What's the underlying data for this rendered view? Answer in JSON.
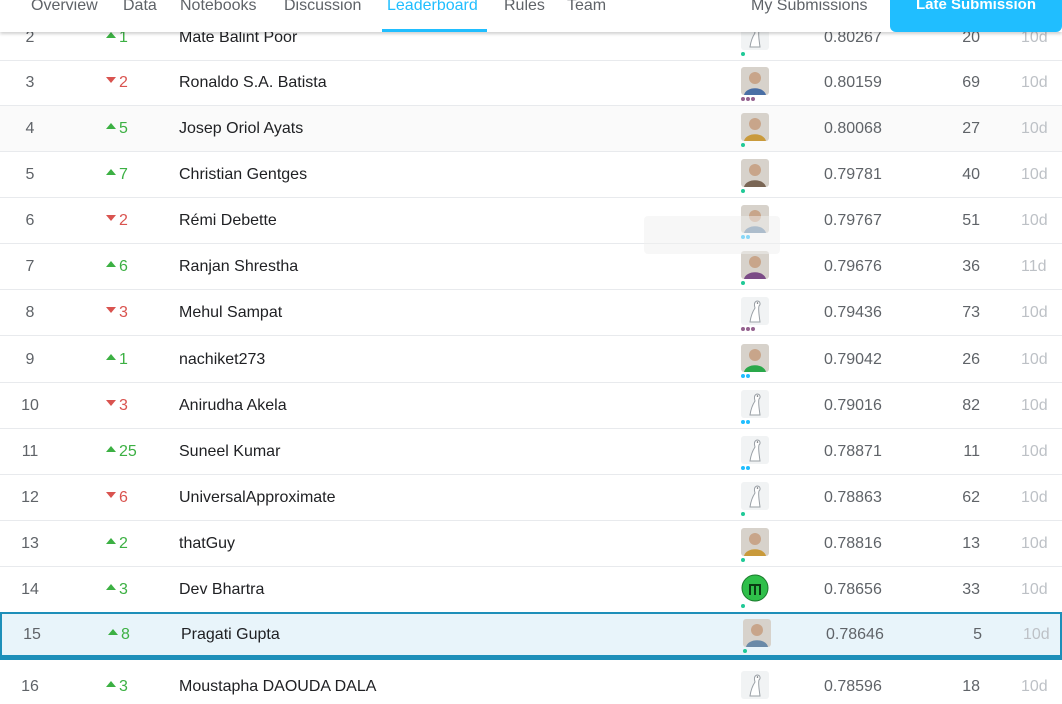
{
  "nav": {
    "tabs": [
      "Overview",
      "Data",
      "Notebooks",
      "Discussion",
      "Leaderboard",
      "Rules",
      "Team"
    ],
    "my_submissions": "My Submissions",
    "late_submission": "Late Submission",
    "accent": "#20beff"
  },
  "rows": [
    {
      "rank": "2",
      "dir": "up",
      "delta": "1",
      "name": "Mate Balint Poor",
      "avatar": "default-avatar-icon",
      "tier": "contributor",
      "score": "0.80267",
      "entries": "20",
      "last": "10d"
    },
    {
      "rank": "3",
      "dir": "down",
      "delta": "2",
      "name": "Ronaldo S.A. Batista",
      "avatar": "photo-avatar",
      "tier": "master",
      "score": "0.80159",
      "entries": "69",
      "last": "10d"
    },
    {
      "rank": "4",
      "dir": "up",
      "delta": "5",
      "name": "Josep Oriol Ayats",
      "avatar": "photo-avatar",
      "tier": "contributor",
      "score": "0.80068",
      "entries": "27",
      "last": "10d"
    },
    {
      "rank": "5",
      "dir": "up",
      "delta": "7",
      "name": "Christian Gentges",
      "avatar": "photo-avatar",
      "tier": "contributor",
      "score": "0.79781",
      "entries": "40",
      "last": "10d"
    },
    {
      "rank": "6",
      "dir": "down",
      "delta": "2",
      "name": "Rémi Debette",
      "avatar": "photo-avatar",
      "tier": "expert",
      "score": "0.79767",
      "entries": "51",
      "last": "10d"
    },
    {
      "rank": "7",
      "dir": "up",
      "delta": "6",
      "name": "Ranjan Shrestha",
      "avatar": "photo-avatar",
      "tier": "contributor",
      "score": "0.79676",
      "entries": "36",
      "last": "11d"
    },
    {
      "rank": "8",
      "dir": "down",
      "delta": "3",
      "name": "Mehul Sampat",
      "avatar": "default-avatar-icon",
      "tier": "master",
      "score": "0.79436",
      "entries": "73",
      "last": "10d"
    },
    {
      "rank": "9",
      "dir": "up",
      "delta": "1",
      "name": "nachiket273",
      "avatar": "photo-avatar",
      "tier": "expert",
      "score": "0.79042",
      "entries": "26",
      "last": "10d"
    },
    {
      "rank": "10",
      "dir": "down",
      "delta": "3",
      "name": "Anirudha Akela",
      "avatar": "default-avatar-icon",
      "tier": "expert",
      "score": "0.79016",
      "entries": "82",
      "last": "10d"
    },
    {
      "rank": "11",
      "dir": "up",
      "delta": "25",
      "name": "Suneel Kumar",
      "avatar": "default-avatar-icon",
      "tier": "expert",
      "score": "0.78871",
      "entries": "11",
      "last": "10d"
    },
    {
      "rank": "12",
      "dir": "down",
      "delta": "6",
      "name": "UniversalApproximate",
      "avatar": "default-avatar-icon",
      "tier": "contributor",
      "score": "0.78863",
      "entries": "62",
      "last": "10d"
    },
    {
      "rank": "13",
      "dir": "up",
      "delta": "2",
      "name": "thatGuy",
      "avatar": "photo-avatar",
      "tier": "contributor",
      "score": "0.78816",
      "entries": "13",
      "last": "10d"
    },
    {
      "rank": "14",
      "dir": "up",
      "delta": "3",
      "name": "Dev Bhartra",
      "avatar": "logo-avatar",
      "tier": "contributor",
      "score": "0.78656",
      "entries": "33",
      "last": "10d"
    },
    {
      "rank": "15",
      "dir": "up",
      "delta": "8",
      "name": "Pragati Gupta",
      "avatar": "photo-avatar",
      "tier": "contributor",
      "score": "0.78646",
      "entries": "5",
      "last": "10d"
    },
    {
      "rank": "16",
      "dir": "up",
      "delta": "3",
      "name": "Moustapha DAOUDA DALA",
      "avatar": "default-avatar-icon",
      "tier": "none",
      "score": "0.78596",
      "entries": "18",
      "last": "10d"
    }
  ],
  "colors": {
    "up": "#3cb043",
    "down": "#d9534f",
    "tier_contributor": "#20c997",
    "tier_expert": "#20beff",
    "tier_master": "#95628f",
    "highlight_border": "#1d8fb9",
    "highlight_bg": "#e8f4fa"
  }
}
